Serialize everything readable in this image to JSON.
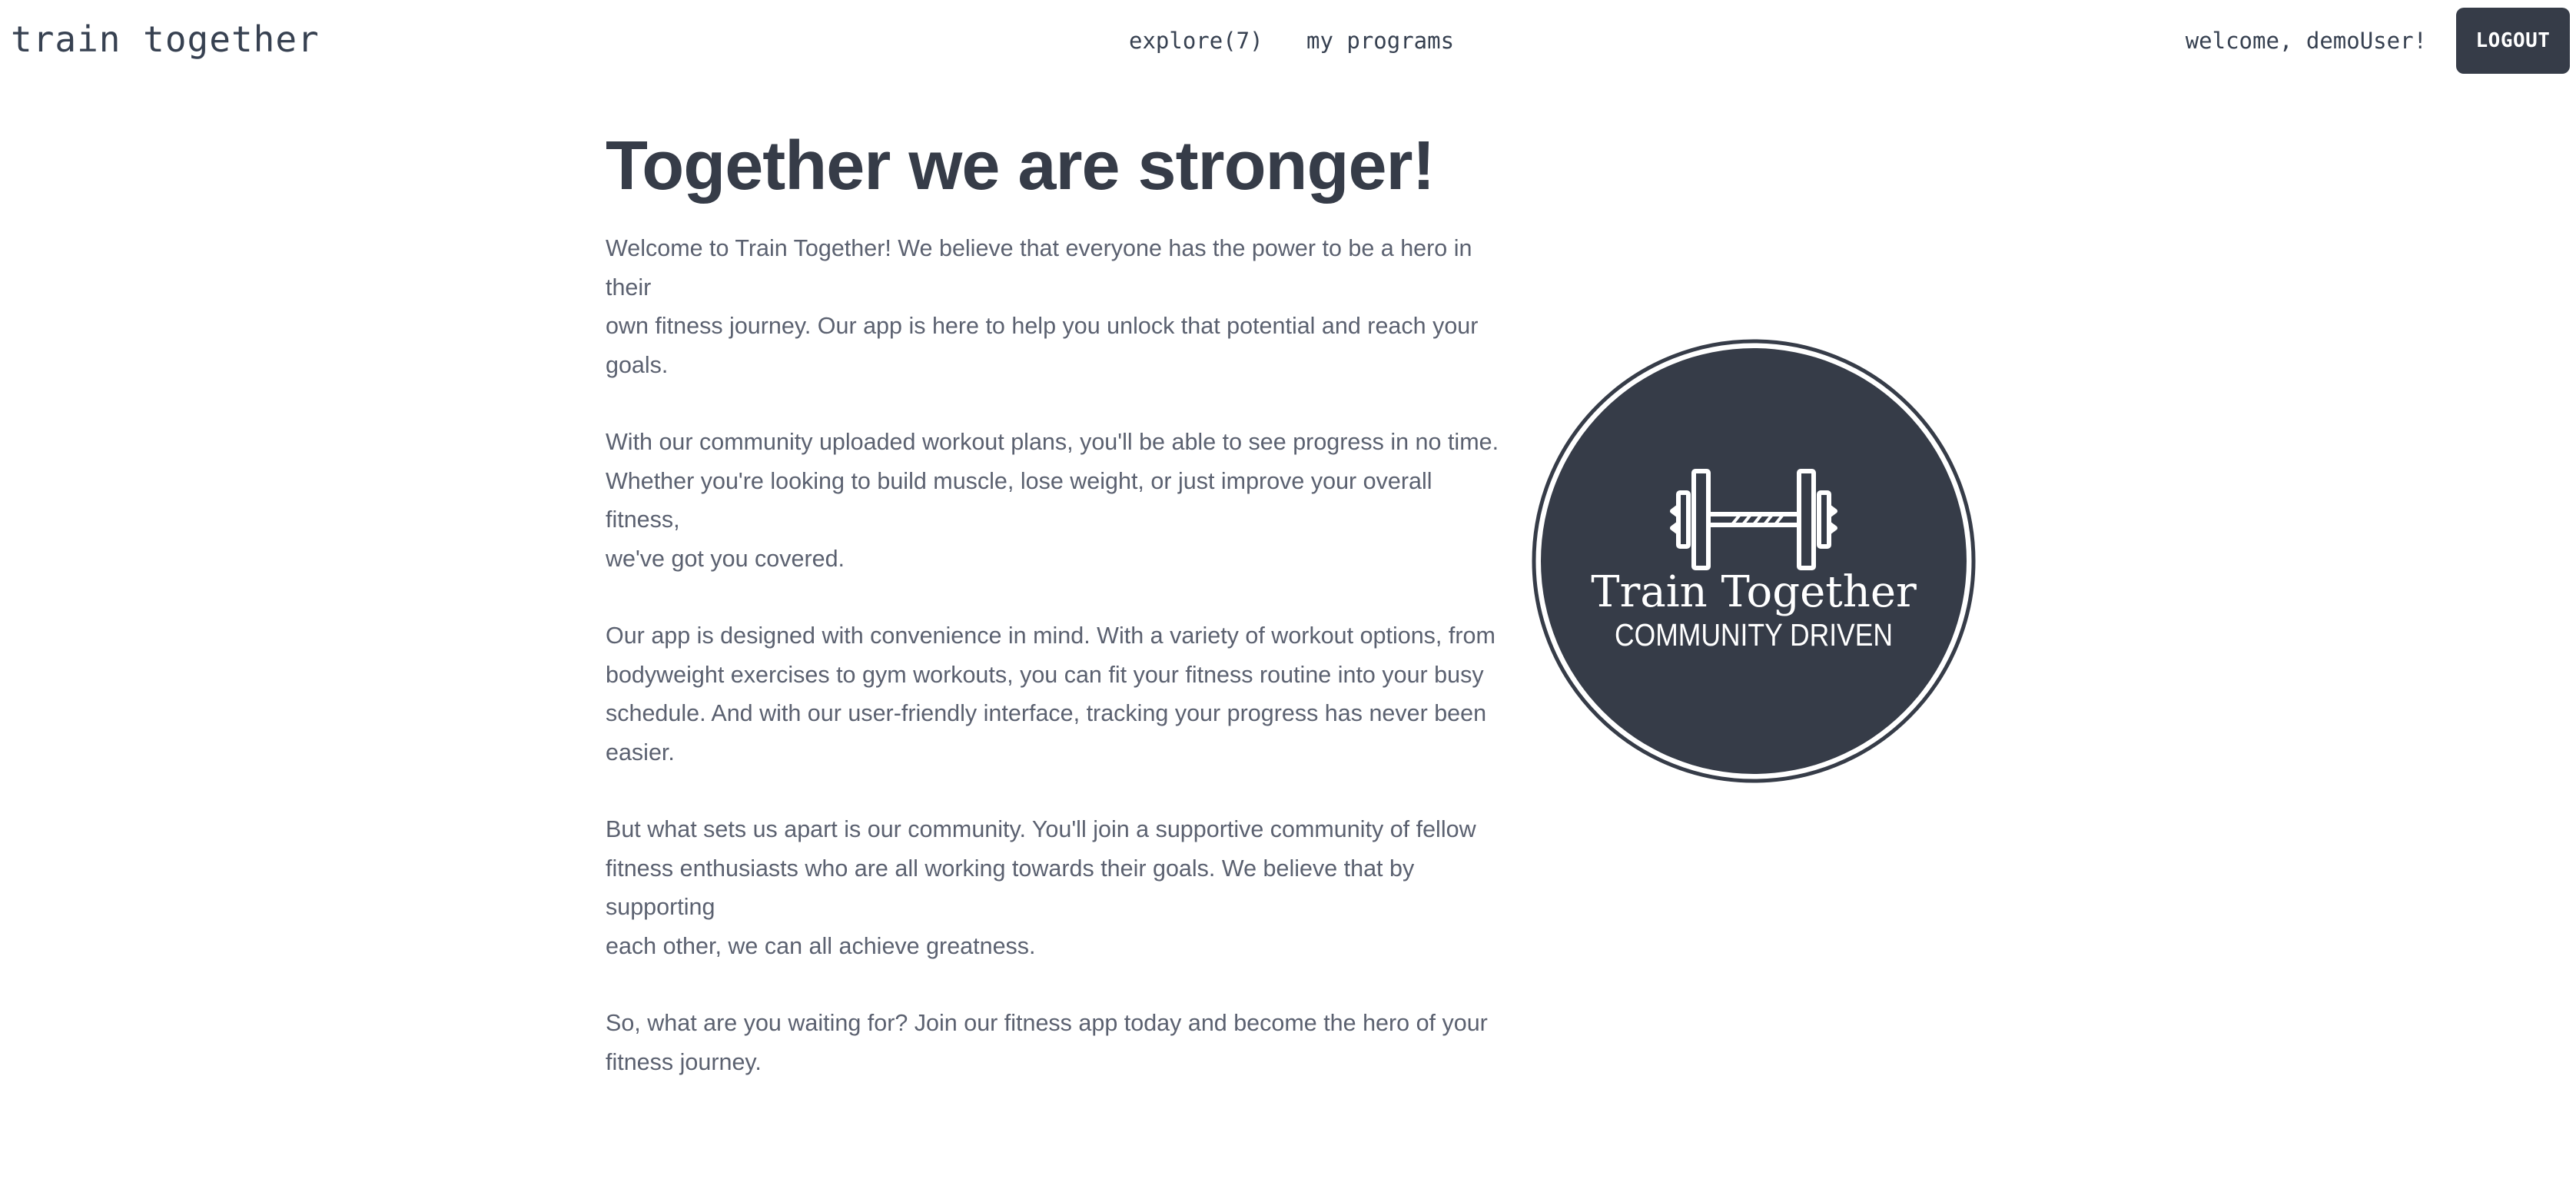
{
  "navbar": {
    "brand": "train together",
    "links": [
      {
        "label": "explore(7)"
      },
      {
        "label": "my programs"
      }
    ],
    "welcome": "welcome, demoUser!",
    "logout_label": "LOGOUT"
  },
  "main": {
    "title": "Together we are stronger!",
    "paragraphs": [
      {
        "lines": [
          "Welcome to Train Together! We believe that everyone has the power to be a hero in their",
          "own fitness journey. Our app is here to help you unlock that potential and reach your",
          "goals."
        ]
      },
      {
        "lines": [
          "With our community uploaded workout plans, you'll be able to see progress in no time.",
          "Whether you're looking to build muscle, lose weight, or just improve your overall fitness,",
          "we've got you covered."
        ]
      },
      {
        "lines": [
          "Our app is designed with convenience in mind. With a variety of workout options, from",
          "bodyweight exercises to gym workouts, you can fit your fitness routine into your busy",
          "schedule. And with our user-friendly interface, tracking your progress has never been",
          "easier."
        ]
      },
      {
        "lines": [
          "But what sets us apart is our community. You'll join a supportive community of fellow",
          "fitness enthusiasts who are all working towards their goals. We believe that by supporting",
          "each other, we can all achieve greatness."
        ]
      },
      {
        "lines": [
          "So, what are you waiting for? Join our fitness app today and become the hero of your",
          "fitness journey."
        ]
      }
    ]
  },
  "logo": {
    "icon": "barbell-icon",
    "line1": "Train Together",
    "line2": "COMMUNITY DRIVEN",
    "background_color": "#363c48",
    "foreground_color": "#ffffff"
  },
  "colors": {
    "primary_dark": "#363c48",
    "body_text": "#5b6170",
    "nav_text": "#374151",
    "background": "#ffffff"
  }
}
